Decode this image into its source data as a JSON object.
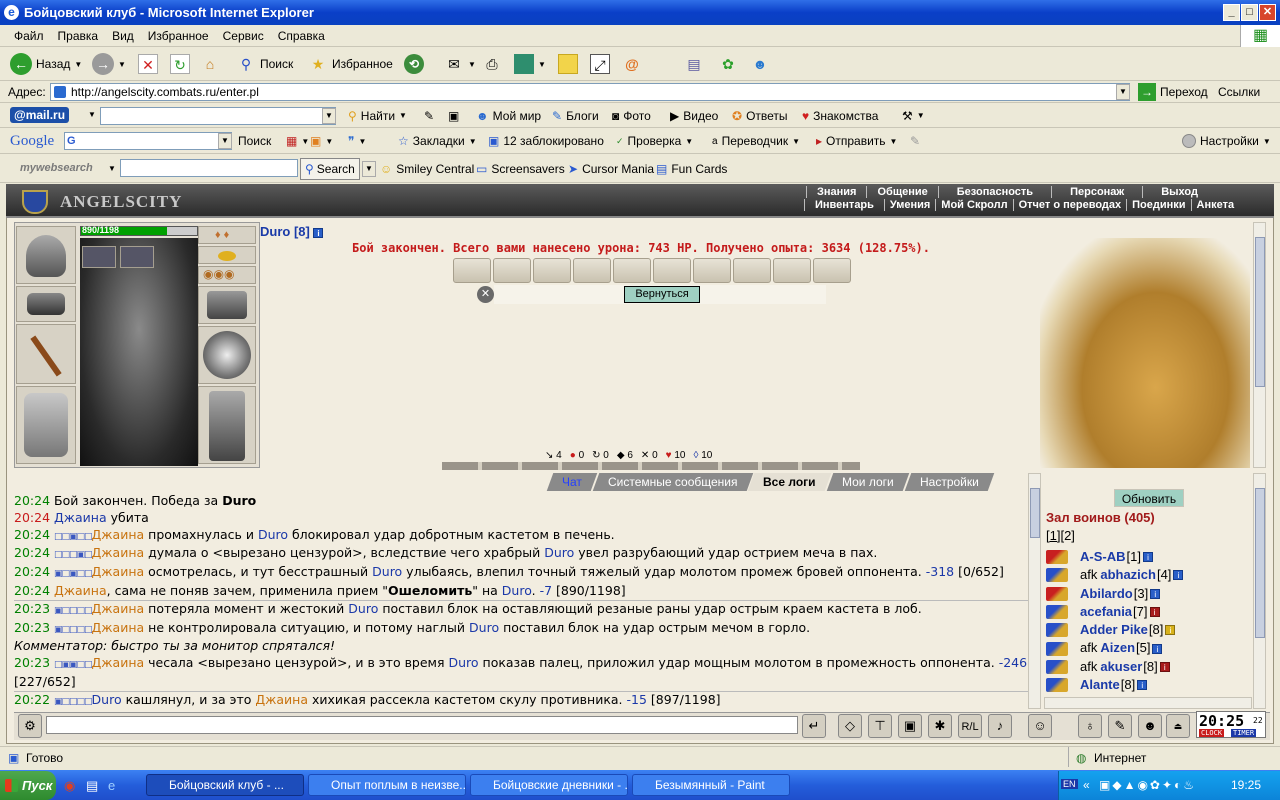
{
  "window": {
    "title": "Бойцовский клуб - Microsoft Internet Explorer"
  },
  "menu": [
    "Файл",
    "Правка",
    "Вид",
    "Избранное",
    "Сервис",
    "Справка"
  ],
  "toolbar": {
    "back": "Назад",
    "search": "Поиск",
    "favorites": "Избранное"
  },
  "address": {
    "label": "Адрес:",
    "url": "http://angelscity.combats.ru/enter.pl",
    "go": "Переход",
    "links": "Ссылки"
  },
  "mailru": {
    "logo": "@mail.ru",
    "find": "Найти",
    "items": [
      "Мой мир",
      "Блоги",
      "Фото",
      "Видео",
      "Ответы",
      "Знакомства"
    ]
  },
  "google": {
    "logo": "Google",
    "search": "Поиск",
    "bookmarks": "Закладки",
    "blocked": "12 заблокировано",
    "check": "Проверка",
    "translate": "Переводчик",
    "send": "Отправить",
    "settings": "Настройки"
  },
  "mywebsearch": {
    "logo": "mywebsearch",
    "search": "Search",
    "items": [
      "Smiley Central",
      "Screensavers",
      "Cursor Mania",
      "Fun Cards"
    ]
  },
  "game": {
    "logo": "ANGELSCITY",
    "nav_top": [
      "Знания",
      "Общение",
      "Безопасность",
      "Персонаж",
      "Выход"
    ],
    "nav_bottom": [
      "Инвентарь",
      "Умения",
      "Мой Скролл",
      "Отчет о переводах",
      "Поединки",
      "Анкета"
    ],
    "hp": "890/1198",
    "hp_fraction": 0.743,
    "fighter": "Duro [8]",
    "battle_message": "Бой закончен. Всего вами нанесено урона: 743 HP. Получено опыта: 3634 (128.75%).",
    "back_button": "Вернуться",
    "stats": [
      "4",
      "0",
      "0",
      "6",
      "0",
      "10",
      "10"
    ],
    "tabs": [
      "Чат",
      "Системные сообщения",
      "Все логи",
      "Мои логи",
      "Настройки"
    ],
    "refresh": "Обновить",
    "hall": "Зал воинов (405)",
    "pages": [
      "[1]",
      "[2]"
    ],
    "warriors": [
      {
        "prefix": "",
        "name": "A-S-AB",
        "level": "[1]"
      },
      {
        "prefix": "afk ",
        "name": "abhazich",
        "level": "[4]"
      },
      {
        "prefix": "",
        "name": "Abilardo",
        "level": "[3]"
      },
      {
        "prefix": "",
        "name": "acefania",
        "level": "[7]"
      },
      {
        "prefix": "",
        "name": "Adder Pike",
        "level": "[8]"
      },
      {
        "prefix": "afk ",
        "name": "Aizen",
        "level": "[5]"
      },
      {
        "prefix": "afk ",
        "name": "akuser",
        "level": "[8]"
      },
      {
        "prefix": "",
        "name": "Alante",
        "level": "[8]"
      }
    ],
    "clock": "20:25",
    "clock_sec": "22",
    "clock_label": "CLOCK",
    "timer_label": "TIMER"
  },
  "chat": {
    "lines": [
      {
        "time": "20:24",
        "parts": [
          {
            "t": "Бой закончен. Победа за "
          },
          {
            "t": "Duro",
            "c": "bold"
          }
        ]
      },
      {
        "time": "20:24",
        "red": true,
        "parts": [
          {
            "t": "Джаина",
            "c": "pb"
          },
          {
            "t": " убита"
          }
        ]
      },
      {
        "time": "20:24",
        "boxes": "□□▣□□",
        "parts": [
          {
            "t": "Джаина",
            "c": "po"
          },
          {
            "t": " промахнулась и "
          },
          {
            "t": "Duro",
            "c": "pb"
          },
          {
            "t": " блокировал удар добротным кастетом в печень."
          }
        ]
      },
      {
        "time": "20:24",
        "boxes": "□□□▣□",
        "parts": [
          {
            "t": "Джаина",
            "c": "po"
          },
          {
            "t": " думала о <вырезано цензурой>, вследствие чего храбрый "
          },
          {
            "t": "Duro",
            "c": "pb"
          },
          {
            "t": " увел разрубающий удар острием меча в пах."
          }
        ]
      },
      {
        "time": "20:24",
        "boxes": "▣□▣□□",
        "parts": [
          {
            "t": "Джаина",
            "c": "po"
          },
          {
            "t": " осмотрелась, и тут бесстрашный "
          },
          {
            "t": "Duro",
            "c": "pb"
          },
          {
            "t": " улыбаясь, влепил точный тяжелый удар молотом промеж бровей оппонента. "
          },
          {
            "t": "-318",
            "c": "dmg"
          },
          {
            "t": " [0/652]"
          }
        ]
      },
      {
        "time": "20:24",
        "parts": [
          {
            "t": "Джаина",
            "c": "po"
          },
          {
            "t": ", сама не поняв зачем, применила прием \""
          },
          {
            "t": "Ошеломить",
            "c": "bold"
          },
          {
            "t": "\" на "
          },
          {
            "t": "Duro",
            "c": "pb"
          },
          {
            "t": ". "
          },
          {
            "t": "-7",
            "c": "dmg"
          },
          {
            "t": " [890/1198]"
          }
        ]
      },
      {
        "time": "20:23",
        "sep": true,
        "boxes": "▣□□□□",
        "parts": [
          {
            "t": "Джаина",
            "c": "po"
          },
          {
            "t": " потеряла момент и жестокий "
          },
          {
            "t": "Duro",
            "c": "pb"
          },
          {
            "t": " поставил блок на оставляющий резаные раны удар острым краем кастета в лоб."
          }
        ]
      },
      {
        "time": "20:23",
        "boxes": "▣□□□□",
        "parts": [
          {
            "t": "Джаина",
            "c": "po"
          },
          {
            "t": " не контролировала ситуацию, и потому наглый "
          },
          {
            "t": "Duro",
            "c": "pb"
          },
          {
            "t": " поставил блок на удар острым мечом в горло."
          }
        ]
      },
      {
        "time": "",
        "parts": [
          {
            "t": "Комментатор: быстро ты за монитор спрятался!",
            "c": "italic"
          }
        ]
      },
      {
        "time": "20:23",
        "boxes": "□▣▣□□",
        "parts": [
          {
            "t": "Джаина",
            "c": "po"
          },
          {
            "t": " чесала <вырезано цензурой>, и в это время "
          },
          {
            "t": "Duro",
            "c": "pb"
          },
          {
            "t": " показав палец, приложил удар мощным молотом в промежность оппонента. "
          },
          {
            "t": "-246",
            "c": "dmg"
          },
          {
            "t": " [227/652]"
          }
        ]
      },
      {
        "time": "20:22",
        "sep": true,
        "boxes": "▣□□□□",
        "parts": [
          {
            "t": "Duro",
            "c": "pb"
          },
          {
            "t": " кашлянул, и за это "
          },
          {
            "t": "Джаина",
            "c": "po"
          },
          {
            "t": " хихикая рассекла кастетом скулу противника. "
          },
          {
            "t": "-15",
            "c": "dmg"
          },
          {
            "t": " [897/1198]"
          }
        ]
      }
    ]
  },
  "statusbar": {
    "text": "Готово",
    "zone": "Интернет"
  },
  "taskbar": {
    "start": "Пуск",
    "tasks": [
      "Бойцовский клуб - ...",
      "Опыт поплым в неизве...",
      "Бойцовские дневники - ...",
      "Безымянный - Paint"
    ],
    "time": "19:25",
    "lang": "EN"
  }
}
